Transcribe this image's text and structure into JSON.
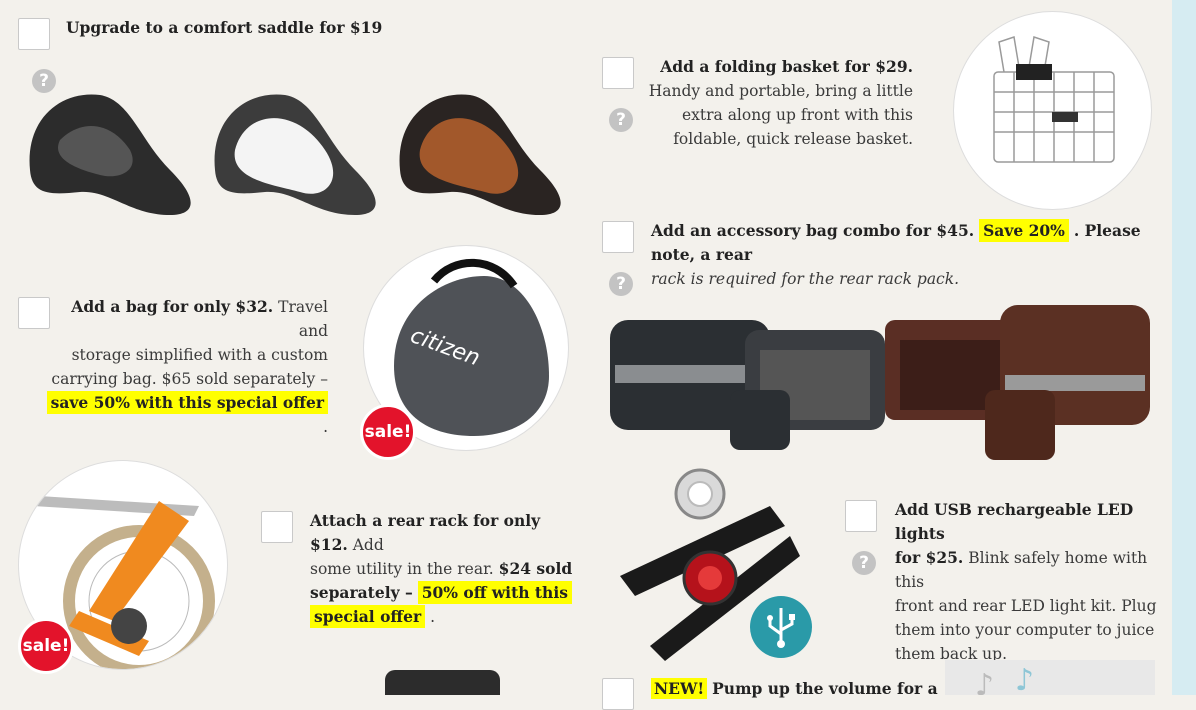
{
  "saddle": {
    "title": "Upgrade to a comfort saddle for $19"
  },
  "basket": {
    "title": "Add a folding basket for $29.",
    "desc1": "Handy and portable, bring a little",
    "desc2": "extra along up front with this",
    "desc3": "foldable, quick release basket."
  },
  "bag": {
    "title": "Add a bag for only $32.",
    "desc1": "Travel and",
    "desc2": "storage simplified with a custom",
    "desc3": "carrying bag. $65 sold separately –",
    "highlight": "save 50% with this special offer",
    "end": ".",
    "sale_badge": "sale!",
    "logo_text": "citizen"
  },
  "accessory": {
    "title": "Add an accessory bag combo for $45.",
    "highlight": "Save 20%",
    "note1": ". Please note, a rear",
    "note2": "rack is required for the rear rack pack."
  },
  "rack": {
    "title": "Attach a rear rack for only $12.",
    "desc1": "Add",
    "desc2": "some utility in the rear.",
    "bold1": "$24 sold",
    "bold2": "separately –",
    "highlight1": "50% off with this",
    "highlight2": "special offer",
    "end": ".",
    "sale_badge": "sale!"
  },
  "lights": {
    "title1": "Add USB rechargeable LED lights",
    "title2": "for $25.",
    "desc1": "Blink safely home with this",
    "desc2": "front and rear LED light kit. Plug",
    "desc3": "them into your computer to juice",
    "desc4": "them back up."
  },
  "speaker": {
    "badge": "NEW!",
    "title": "Pump up the volume for a"
  },
  "icons": {
    "help": "?"
  },
  "colors": {
    "highlight": "#ffff00",
    "sale_red": "#e3132b",
    "usb_teal": "#2a9aa8"
  }
}
